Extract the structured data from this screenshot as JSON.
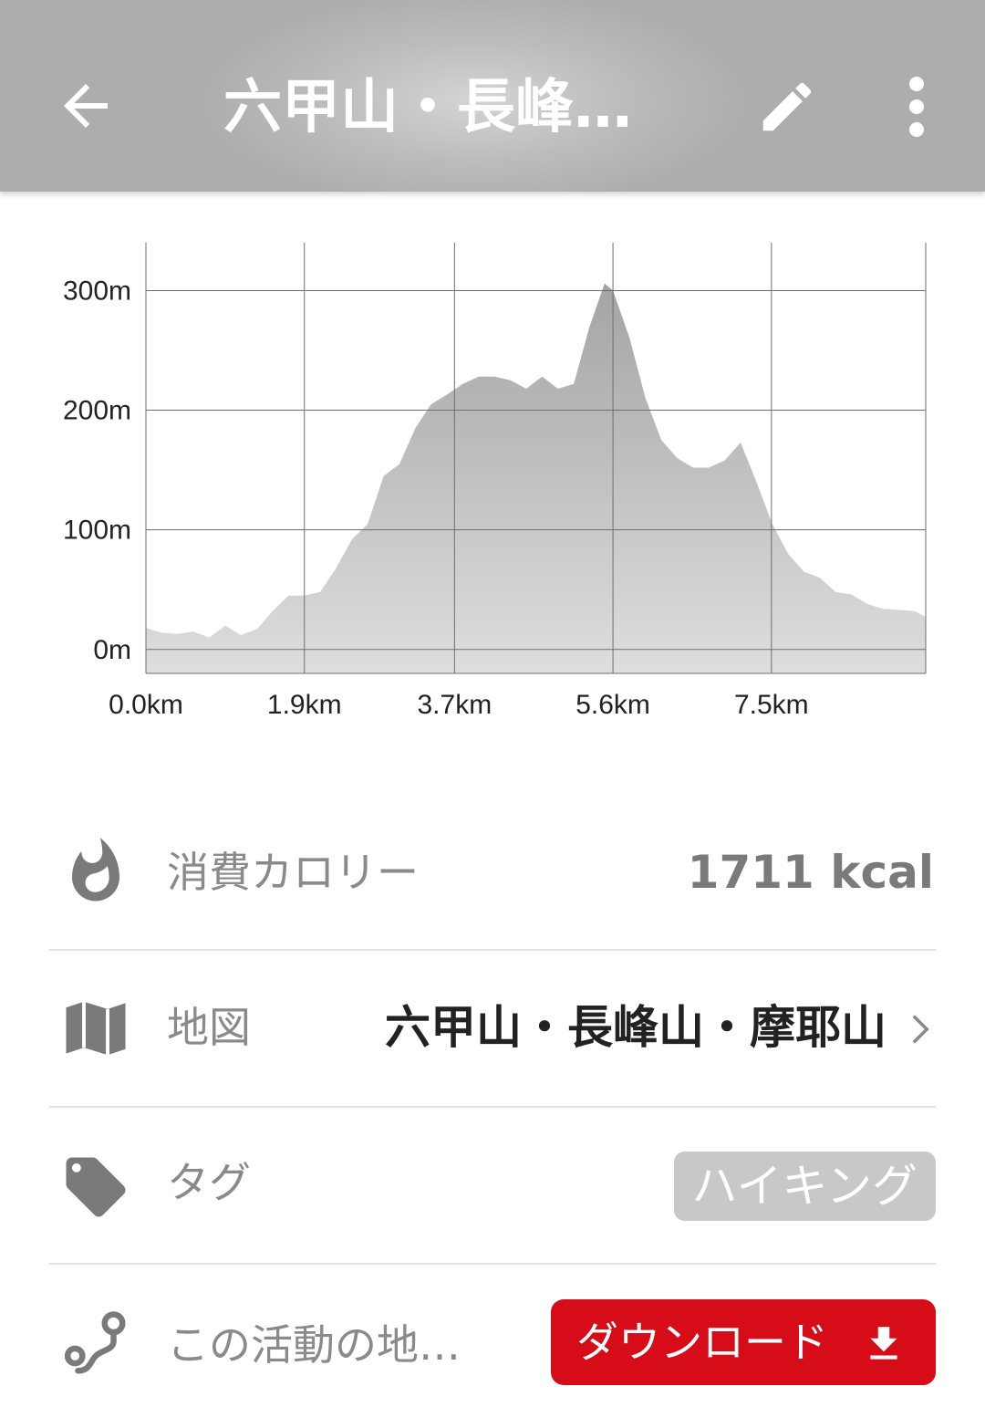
{
  "appbar": {
    "title": "六甲山・長峰…"
  },
  "chart_data": {
    "type": "area",
    "x_unit": "km",
    "y_unit": "m",
    "xticks": [
      "0.0km",
      "1.9km",
      "3.7km",
      "5.6km",
      "7.5km"
    ],
    "yticks": [
      "0m",
      "100m",
      "200m",
      "300m"
    ],
    "xlim": [
      0,
      9.35
    ],
    "ylim": [
      -20,
      340
    ],
    "grid": true,
    "x": [
      0.0,
      0.19,
      0.38,
      0.57,
      0.76,
      0.95,
      1.14,
      1.33,
      1.52,
      1.71,
      1.9,
      2.09,
      2.28,
      2.47,
      2.66,
      2.85,
      3.04,
      3.23,
      3.42,
      3.61,
      3.8,
      3.99,
      4.18,
      4.37,
      4.56,
      4.75,
      4.94,
      5.13,
      5.32,
      5.5,
      5.6,
      5.8,
      5.99,
      6.18,
      6.37,
      6.56,
      6.75,
      6.94,
      7.13,
      7.32,
      7.51,
      7.7,
      7.89,
      8.08,
      8.27,
      8.46,
      8.65,
      8.84,
      9.03,
      9.22,
      9.35
    ],
    "y": [
      18,
      14,
      13,
      15,
      10,
      20,
      12,
      17,
      32,
      45,
      45,
      48,
      68,
      92,
      105,
      145,
      155,
      185,
      205,
      213,
      222,
      228,
      228,
      225,
      218,
      228,
      218,
      222,
      270,
      306,
      300,
      260,
      210,
      175,
      160,
      152,
      152,
      158,
      173,
      140,
      105,
      80,
      65,
      60,
      48,
      46,
      38,
      34,
      33,
      32,
      27
    ]
  },
  "stats": [
    {
      "icon": "flame-icon",
      "label": "消費カロリー",
      "value": "1711 kcal"
    },
    {
      "icon": "map-icon",
      "label": "地図",
      "value": "六甲山・長峰山・摩耶山"
    },
    {
      "icon": "tag-icon",
      "label": "タグ",
      "value": "ハイキング"
    },
    {
      "icon": "route-icon",
      "label": "この活動の地…",
      "value": "ダウンロード"
    }
  ],
  "colors": {
    "accent": "#d60c18",
    "appbar": "#b8b8b8",
    "chart_fill_top": "#a4a4a4",
    "chart_fill_bottom": "#dcdcdc"
  }
}
